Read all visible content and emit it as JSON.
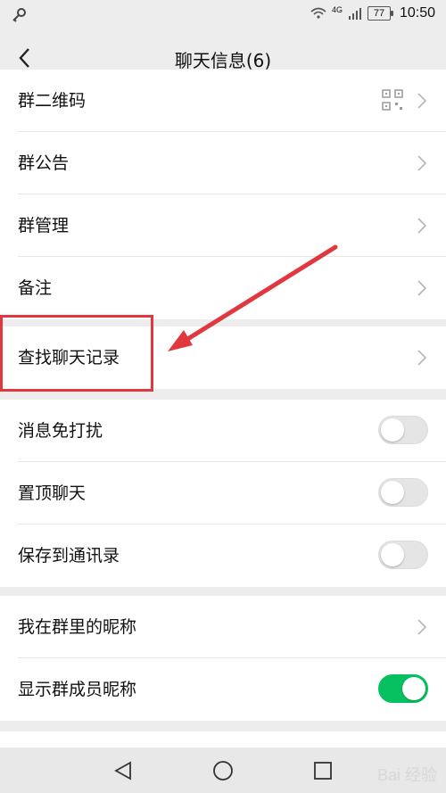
{
  "status_bar": {
    "network": "4G",
    "battery": "77",
    "time": "10:50"
  },
  "header": {
    "title": "聊天信息(6)"
  },
  "section1": [
    {
      "label": "群二维码",
      "accessory": "qr-code-icon"
    },
    {
      "label": "群公告"
    },
    {
      "label": "群管理"
    },
    {
      "label": "备注"
    }
  ],
  "section2": [
    {
      "label": "查找聊天记录"
    }
  ],
  "section3": [
    {
      "label": "消息免打扰",
      "toggle": false
    },
    {
      "label": "置顶聊天",
      "toggle": false
    },
    {
      "label": "保存到通讯录",
      "toggle": false
    }
  ],
  "section4": [
    {
      "label": "我在群里的昵称"
    },
    {
      "label": "显示群成员昵称",
      "toggle": true
    }
  ],
  "annotation": {
    "color": "#e0383e"
  },
  "colors": {
    "toggle_on": "#07c160"
  },
  "watermark": "Bai 经验"
}
